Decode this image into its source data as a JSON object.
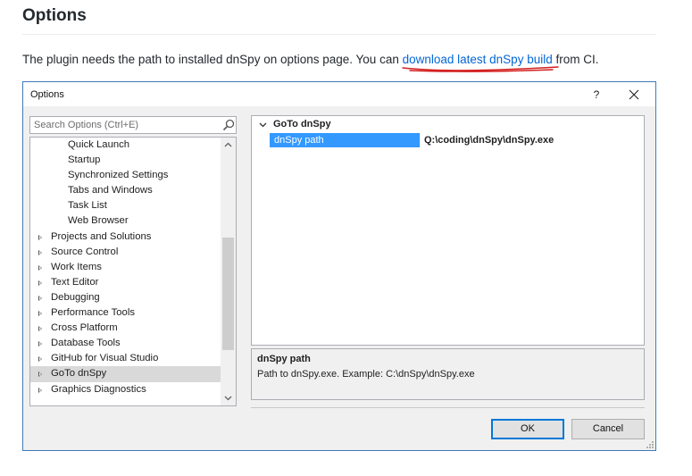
{
  "doc": {
    "heading": "Options",
    "text_before": "The plugin needs the path to installed dnSpy on options page. You can ",
    "link_text": "download latest dnSpy build",
    "text_after": " from CI."
  },
  "dialog": {
    "title": "Options",
    "help_label": "?",
    "close_icon": "close-icon",
    "search": {
      "placeholder": "Search Options (Ctrl+E)",
      "value": "",
      "icon": "search-icon"
    },
    "tree": {
      "items": [
        {
          "label": "Quick Launch",
          "level": 1
        },
        {
          "label": "Startup",
          "level": 1
        },
        {
          "label": "Synchronized Settings",
          "level": 1
        },
        {
          "label": "Tabs and Windows",
          "level": 1
        },
        {
          "label": "Task List",
          "level": 1
        },
        {
          "label": "Web Browser",
          "level": 1
        },
        {
          "label": "Projects and Solutions",
          "level": 0
        },
        {
          "label": "Source Control",
          "level": 0
        },
        {
          "label": "Work Items",
          "level": 0
        },
        {
          "label": "Text Editor",
          "level": 0
        },
        {
          "label": "Debugging",
          "level": 0
        },
        {
          "label": "Performance Tools",
          "level": 0
        },
        {
          "label": "Cross Platform",
          "level": 0
        },
        {
          "label": "Database Tools",
          "level": 0
        },
        {
          "label": "GitHub for Visual Studio",
          "level": 0
        },
        {
          "label": "GoTo dnSpy",
          "level": 0,
          "selected": true
        },
        {
          "label": "Graphics Diagnostics",
          "level": 0
        }
      ]
    },
    "property_grid": {
      "category": "GoTo dnSpy",
      "property_name": "dnSpy path",
      "property_value": "Q:\\coding\\dnSpy\\dnSpy.exe"
    },
    "description": {
      "title": "dnSpy path",
      "text": "Path to dnSpy.exe. Example: C:\\dnSpy\\dnSpy.exe"
    },
    "buttons": {
      "ok": "OK",
      "cancel": "Cancel"
    },
    "colors": {
      "selection": "#3399ff",
      "accent": "#0078d7",
      "link": "#0366d6",
      "annotation": "#d32020"
    }
  }
}
